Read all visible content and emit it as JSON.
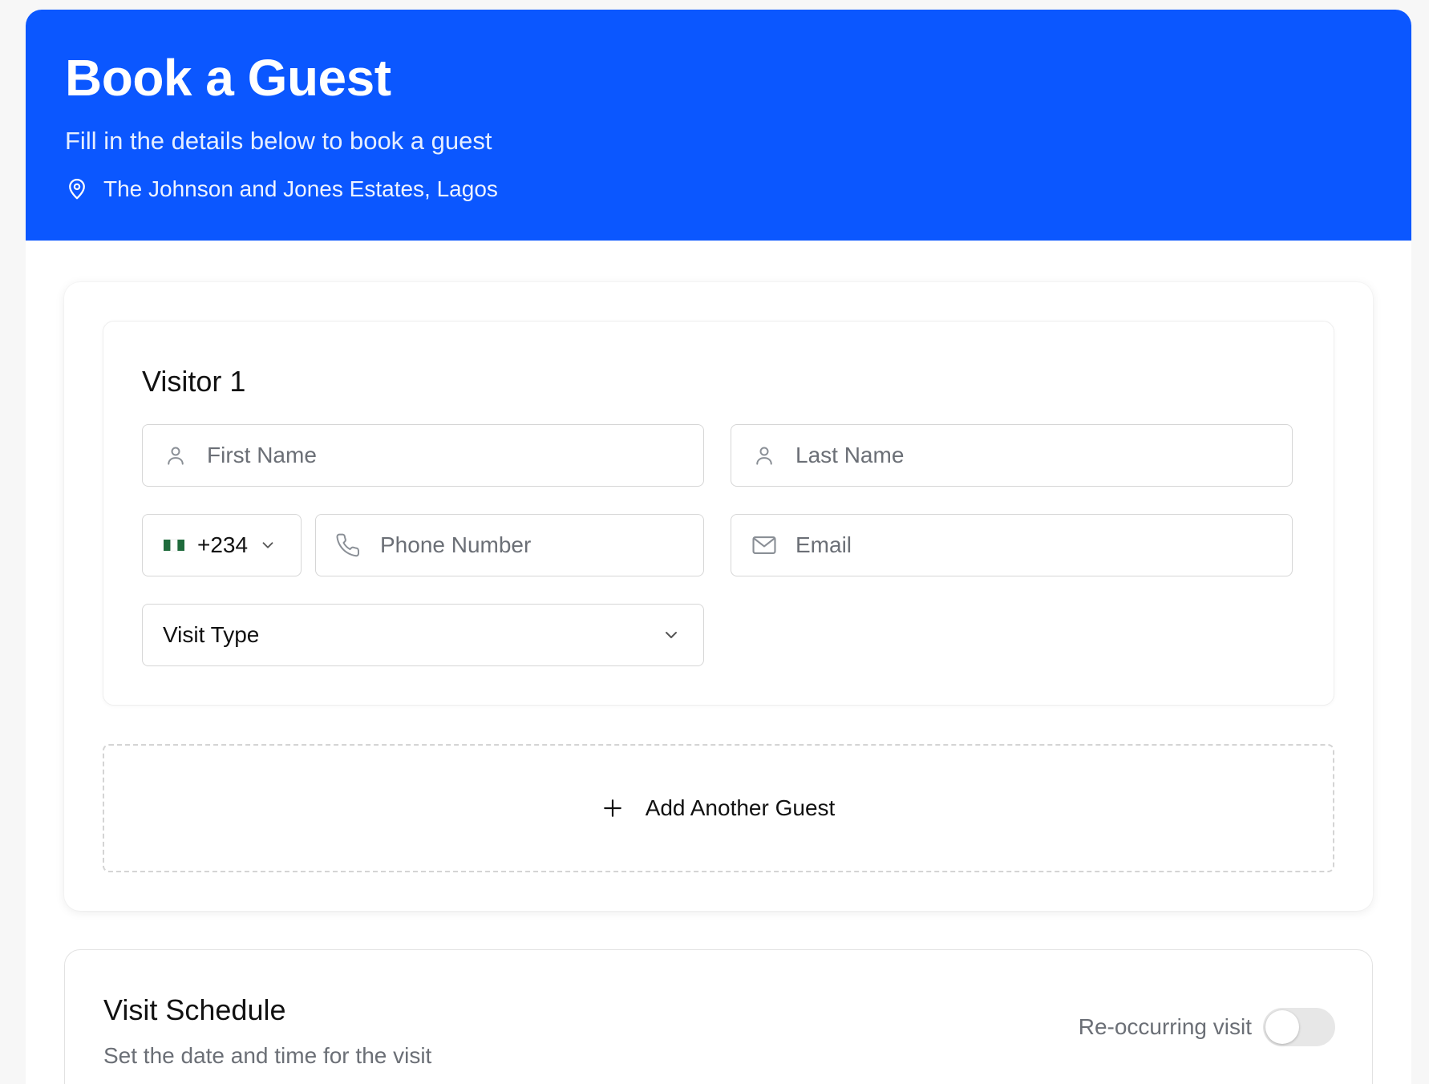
{
  "header": {
    "title": "Book a Guest",
    "subtitle": "Fill in the details below to book a guest",
    "location": "The Johnson and Jones Estates, Lagos",
    "location_icon": "map-pin-icon",
    "background_color": "#0b57ff"
  },
  "visitor": {
    "title": "Visitor 1",
    "first_name": {
      "placeholder": "First Name",
      "icon": "user-icon",
      "value": ""
    },
    "last_name": {
      "placeholder": "Last Name",
      "icon": "user-icon",
      "value": ""
    },
    "country_code": {
      "value": "+234",
      "flag": "nigeria-flag-icon"
    },
    "phone": {
      "placeholder": "Phone Number",
      "icon": "phone-icon",
      "value": ""
    },
    "email": {
      "placeholder": "Email",
      "icon": "mail-icon",
      "value": ""
    },
    "visit_type": {
      "selected": "Visit Type"
    }
  },
  "add_guest": {
    "label": "Add Another Guest",
    "icon": "plus-icon"
  },
  "schedule": {
    "title": "Visit Schedule",
    "subtitle": "Set the date and time for the visit",
    "recurring_label": "Re-occurring visit",
    "recurring_enabled": false
  }
}
